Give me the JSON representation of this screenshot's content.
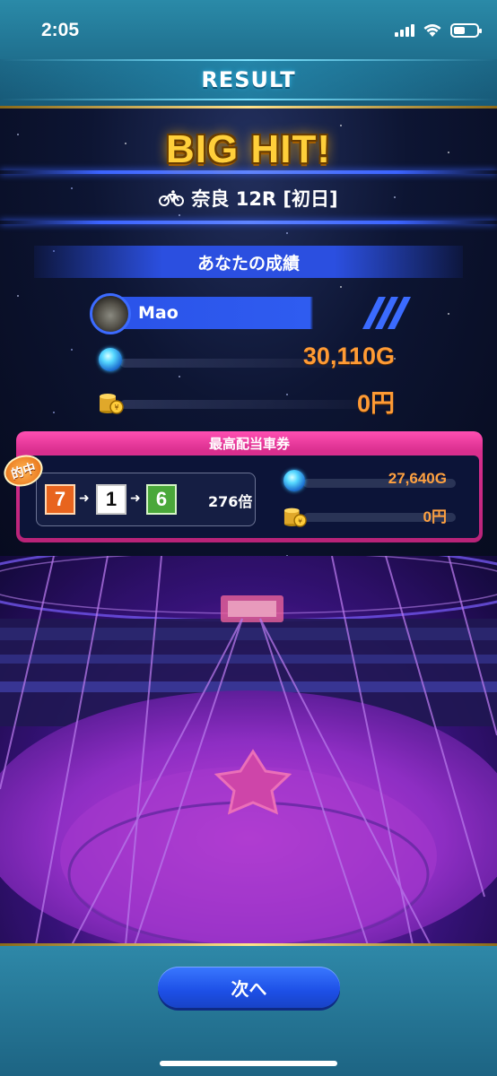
{
  "status_bar": {
    "time": "2:05"
  },
  "header": {
    "title": "RESULT"
  },
  "result": {
    "headline": "BIG HIT!",
    "race": "奈良 12R [初日]",
    "section_title": "あなたの成績",
    "player_name": "Mao",
    "gold_amount": "30,110G",
    "yen_amount": "0円"
  },
  "best_payout": {
    "title": "最高配当車券",
    "hit_badge": "的中",
    "combo": [
      "7",
      "1",
      "6"
    ],
    "odds": "276倍",
    "gold_amount": "27,640G",
    "yen_amount": "0円"
  },
  "footer": {
    "next_label": "次へ"
  },
  "colors": {
    "accent_blue": "#2b4fe0",
    "value_orange": "#ff9b35",
    "payout_pink": "#d92e8e",
    "header_teal": "#1f6f8e"
  }
}
